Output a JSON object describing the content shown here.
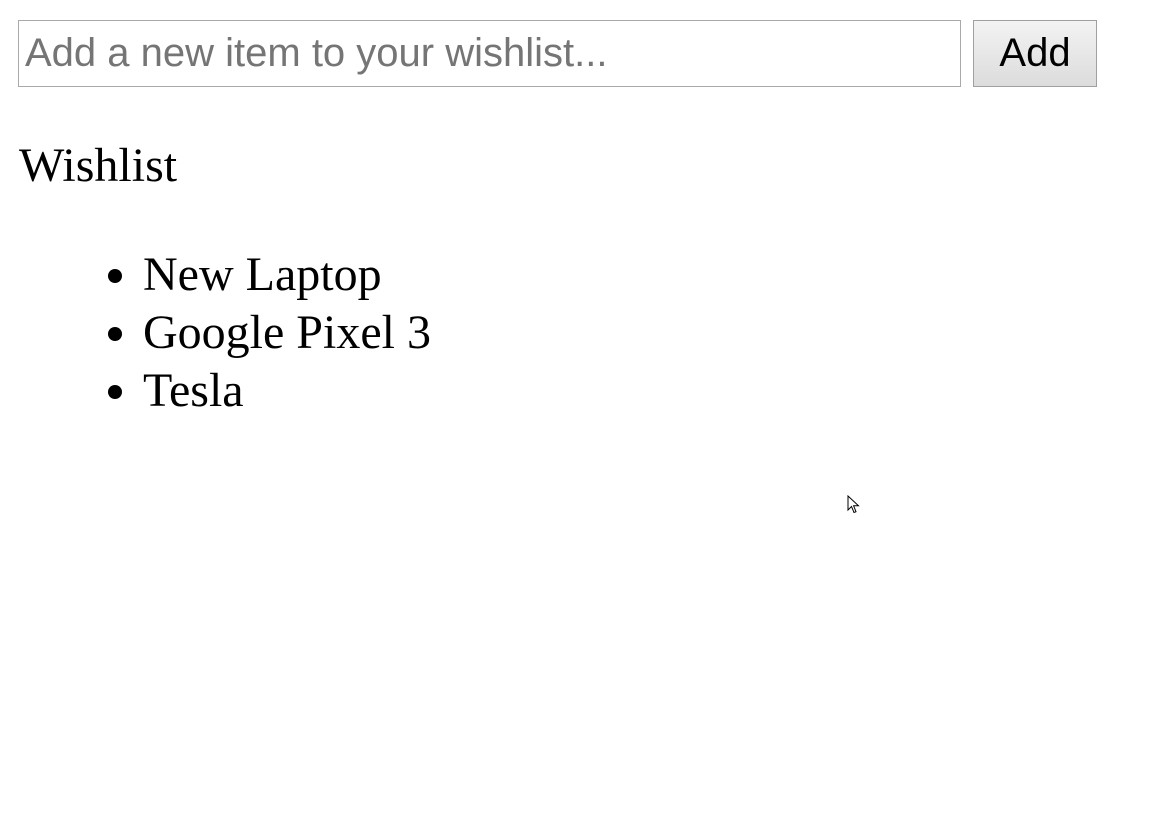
{
  "form": {
    "input_placeholder": "Add a new item to your wishlist...",
    "input_value": "",
    "add_label": "Add"
  },
  "wishlist": {
    "title": "Wishlist",
    "items": [
      "New Laptop",
      "Google Pixel 3",
      "Tesla"
    ]
  }
}
